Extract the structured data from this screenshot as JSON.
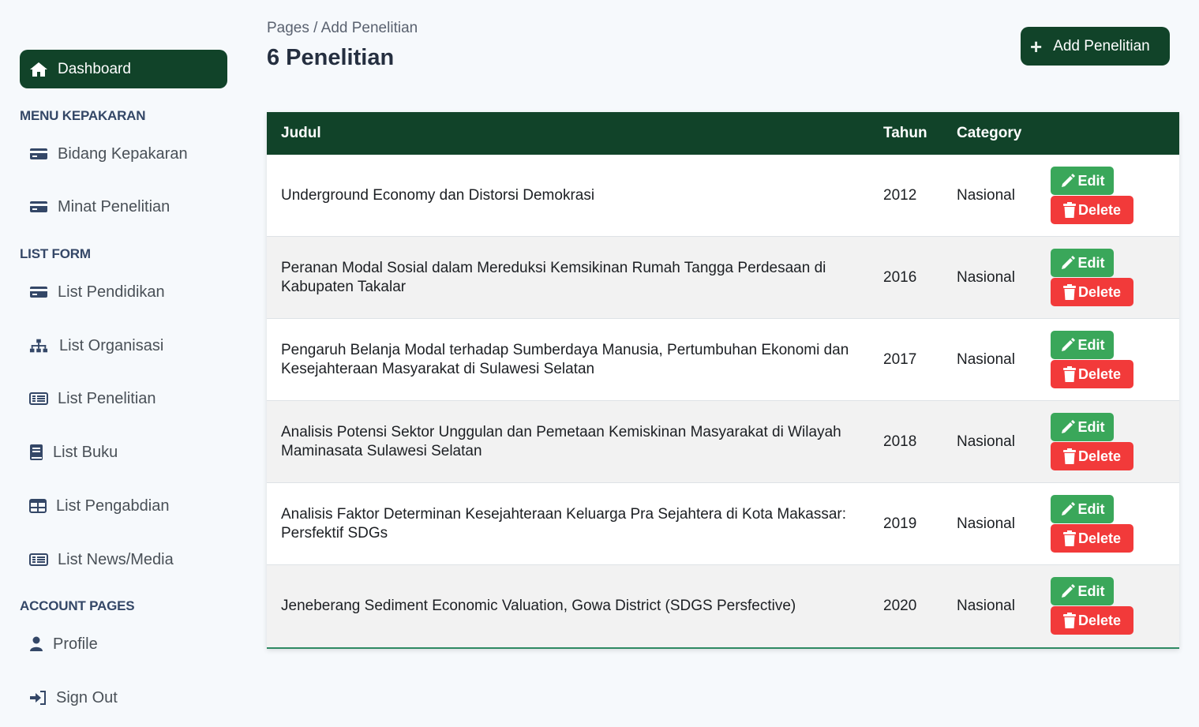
{
  "sidebar": {
    "dashboard_label": "Dashboard",
    "sections": [
      {
        "title": "MENU KEPAKARAN",
        "items": [
          {
            "label": "Bidang Kepakaran",
            "icon": "card-icon"
          },
          {
            "label": "Minat Penelitian",
            "icon": "card-icon"
          }
        ]
      },
      {
        "title": "LIST FORM",
        "items": [
          {
            "label": "List Pendidikan",
            "icon": "card-icon"
          },
          {
            "label": "List Organisasi",
            "icon": "sitemap-icon"
          },
          {
            "label": "List Penelitian",
            "icon": "list-icon"
          },
          {
            "label": "List Buku",
            "icon": "book-icon"
          },
          {
            "label": "List Pengabdian",
            "icon": "table-icon"
          },
          {
            "label": "List News/Media",
            "icon": "list-icon"
          }
        ]
      },
      {
        "title": "ACCOUNT PAGES",
        "items": [
          {
            "label": "Profile",
            "icon": "user-icon"
          },
          {
            "label": "Sign Out",
            "icon": "sign-out-icon"
          }
        ]
      }
    ]
  },
  "header": {
    "breadcrumb": "Pages / Add Penelitian",
    "title": "6 Penelitian",
    "add_button_label": "Add Penelitian"
  },
  "table": {
    "columns": {
      "judul": "Judul",
      "tahun": "Tahun",
      "category": "Category"
    },
    "edit_label": "Edit",
    "delete_label": "Delete",
    "rows": [
      {
        "judul": "Underground Economy dan Distorsi Demokrasi",
        "tahun": "2012",
        "category": "Nasional"
      },
      {
        "judul": "Peranan Modal Sosial dalam Mereduksi Kemsikinan Rumah Tangga Perdesaan di Kabupaten Takalar",
        "tahun": "2016",
        "category": "Nasional"
      },
      {
        "judul": "Pengaruh Belanja Modal terhadap Sumberdaya Manusia, Pertumbuhan Ekonomi dan Kesejahteraan Masyarakat di Sulawesi Selatan",
        "tahun": "2017",
        "category": "Nasional"
      },
      {
        "judul": "Analisis Potensi Sektor Unggulan dan Pemetaan Kemiskinan Masyarakat di Wilayah Maminasata Sulawesi Selatan",
        "tahun": "2018",
        "category": "Nasional"
      },
      {
        "judul": "Analisis Faktor Determinan Kesejahteraan Keluarga Pra Sejahtera di Kota Makassar: Persfektif SDGs",
        "tahun": "2019",
        "category": "Nasional"
      },
      {
        "judul": "Jeneberang Sediment Economic Valuation, Gowa District (SDGS Persfective)",
        "tahun": "2020",
        "category": "Nasional"
      }
    ]
  },
  "colors": {
    "primary_dark_green": "#114329",
    "edit_green": "#3aa75a",
    "delete_red": "#f23a3a",
    "background": "#f6f9fc"
  }
}
